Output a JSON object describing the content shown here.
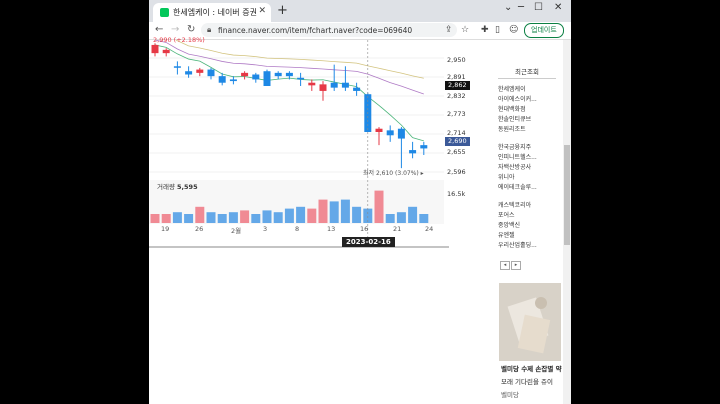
{
  "browser": {
    "tab_title": "한세엠케이 : 네이버 증권",
    "url": "finance.naver.com/item/fchart.naver?code=069640",
    "update_label": "업데이트"
  },
  "chart": {
    "top_value_label": "2,990 (+2.18%)",
    "price_ticks": [
      "2,950",
      "2,891",
      "2,832",
      "2,773",
      "2,714",
      "2,655",
      "2,596"
    ],
    "current_tag": "2,862",
    "hover_tag": "2,690",
    "low_marker": "최저 2,610 (3.07%) ▸",
    "volume_label": "거래량",
    "volume_value": "5,595",
    "volume_scale": "16.5k",
    "date_ticks": [
      "19",
      "26",
      "2월",
      "3",
      "8",
      "13",
      "16",
      "21",
      "24"
    ],
    "hover_date": "2023-02-16"
  },
  "chart_data": {
    "type": "candlestick",
    "series": [
      {
        "name": "price",
        "values": [
          {
            "o": 2960,
            "c": 2985,
            "h": 2990,
            "l": 2950
          },
          {
            "o": 2960,
            "c": 2970,
            "h": 2975,
            "l": 2950
          },
          {
            "o": 2920,
            "c": 2918,
            "h": 2935,
            "l": 2895
          },
          {
            "o": 2905,
            "c": 2895,
            "h": 2920,
            "l": 2885
          },
          {
            "o": 2900,
            "c": 2910,
            "h": 2915,
            "l": 2890
          },
          {
            "o": 2910,
            "c": 2890,
            "h": 2915,
            "l": 2880
          },
          {
            "o": 2890,
            "c": 2870,
            "h": 2900,
            "l": 2862
          },
          {
            "o": 2880,
            "c": 2875,
            "h": 2890,
            "l": 2865
          },
          {
            "o": 2890,
            "c": 2900,
            "h": 2905,
            "l": 2880
          },
          {
            "o": 2895,
            "c": 2880,
            "h": 2900,
            "l": 2870
          },
          {
            "o": 2905,
            "c": 2860,
            "h": 2910,
            "l": 2860
          },
          {
            "o": 2900,
            "c": 2890,
            "h": 2905,
            "l": 2880
          },
          {
            "o": 2900,
            "c": 2890,
            "h": 2905,
            "l": 2880
          },
          {
            "o": 2885,
            "c": 2880,
            "h": 2900,
            "l": 2860
          },
          {
            "o": 2862,
            "c": 2870,
            "h": 2880,
            "l": 2845
          },
          {
            "o": 2845,
            "c": 2865,
            "h": 2875,
            "l": 2815
          },
          {
            "o": 2870,
            "c": 2855,
            "h": 2925,
            "l": 2845
          },
          {
            "o": 2870,
            "c": 2855,
            "h": 2920,
            "l": 2845
          },
          {
            "o": 2855,
            "c": 2845,
            "h": 2870,
            "l": 2830
          },
          {
            "o": 2835,
            "c": 2720,
            "h": 2840,
            "l": 2720
          },
          {
            "o": 2720,
            "c": 2730,
            "h": 2735,
            "l": 2680
          },
          {
            "o": 2725,
            "c": 2710,
            "h": 2740,
            "l": 2690
          },
          {
            "o": 2730,
            "c": 2700,
            "h": 2735,
            "l": 2610
          },
          {
            "o": 2665,
            "c": 2655,
            "h": 2690,
            "l": 2640
          },
          {
            "o": 2680,
            "c": 2670,
            "h": 2690,
            "l": 2650
          }
        ]
      }
    ],
    "volume": [
      5,
      5,
      6,
      5,
      9,
      6,
      5,
      6,
      7,
      5,
      7,
      6,
      8,
      9,
      8,
      13,
      12,
      13,
      9,
      8,
      18,
      5,
      6,
      9,
      5
    ],
    "ylim": [
      2580,
      3000
    ]
  },
  "sidebar": {
    "title": "최근조회",
    "group1": [
      "한세엠케이",
      "아이에스이커...",
      "현대백화점",
      "한솔인티큐브",
      "동원리조트"
    ],
    "group2": [
      "한국금융지주",
      "인피니트헬스...",
      "자백산방공사",
      "위니아",
      "에이테크솔루..."
    ],
    "group3": [
      "캐스텍코리아",
      "포어스",
      "중앙백신",
      "유엔젤",
      "우리산업홀딩..."
    ],
    "ad_text": [
      "벨미당 수제 손잡별 약",
      "모래 기다린을 쥬이",
      "벨미당"
    ]
  },
  "colors": {
    "up": "#e63946",
    "down": "#1e88e5",
    "vol_up": "#f08a94",
    "vol_down": "#64a8e8"
  }
}
